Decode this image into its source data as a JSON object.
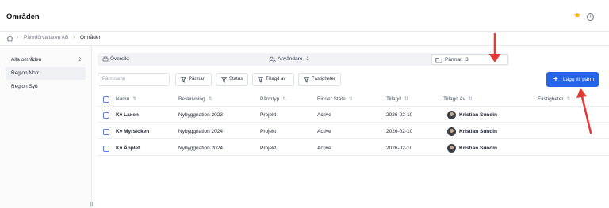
{
  "header": {
    "title": "Områden"
  },
  "icons": {
    "favorite": "star-icon",
    "info": "info-icon",
    "home": "home-icon"
  },
  "colors": {
    "accent": "#2563eb",
    "star": "#f2b705",
    "annotation_arrow": "#e53935"
  },
  "breadcrumb": {
    "items": [
      "Pärmförvaltaren AB",
      "Områden"
    ]
  },
  "sidebar": {
    "items": [
      {
        "label": "Alla områden",
        "count": "2"
      },
      {
        "label": "Region Norr"
      },
      {
        "label": "Region Syd"
      }
    ]
  },
  "tabs": [
    {
      "label": "Översikt"
    },
    {
      "label": "Användare",
      "count": "1"
    },
    {
      "label": "Pärmar",
      "count": "3"
    }
  ],
  "toolbar": {
    "search_placeholder": "Pärmnamn",
    "filters": [
      "Pärmar",
      "Status",
      "Tillagd av",
      "Fastigheter"
    ],
    "add_label": "Lägg till pärm"
  },
  "table": {
    "columns": [
      "Namn",
      "Beskrivning",
      "Pärmtyp",
      "Binder State",
      "Tillagd",
      "Tillagd Av",
      "Fastigheter"
    ],
    "rows": [
      {
        "name": "Kv Laxen",
        "description": "Nybyggnation 2023",
        "type": "Projekt",
        "state": "Active",
        "added": "2026-02-10",
        "added_by": "Kristian Sundin"
      },
      {
        "name": "Kv Myrsloken",
        "description": "Nybyggnation 2024",
        "type": "Projekt",
        "state": "Active",
        "added": "2026-02-10",
        "added_by": "Kristian Sundin"
      },
      {
        "name": "Kv Äpplet",
        "description": "Nybyggnation 2024",
        "type": "Projekt",
        "state": "Active",
        "added": "2026-02-10",
        "added_by": "Kristian Sundin"
      }
    ]
  }
}
